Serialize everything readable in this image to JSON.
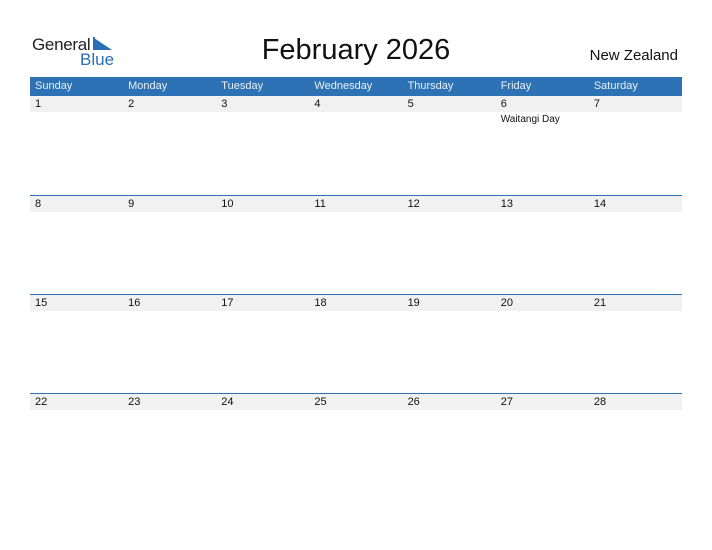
{
  "logo": {
    "line1": "General",
    "line2": "Blue"
  },
  "header": {
    "title": "February 2026",
    "country": "New Zealand"
  },
  "colors": {
    "accent": "#2e72b6",
    "day_bg": "#f1f1f1"
  },
  "weekdays": [
    "Sunday",
    "Monday",
    "Tuesday",
    "Wednesday",
    "Thursday",
    "Friday",
    "Saturday"
  ],
  "weeks": [
    [
      {
        "day": "1",
        "event": ""
      },
      {
        "day": "2",
        "event": ""
      },
      {
        "day": "3",
        "event": ""
      },
      {
        "day": "4",
        "event": ""
      },
      {
        "day": "5",
        "event": ""
      },
      {
        "day": "6",
        "event": "Waitangi Day"
      },
      {
        "day": "7",
        "event": ""
      }
    ],
    [
      {
        "day": "8",
        "event": ""
      },
      {
        "day": "9",
        "event": ""
      },
      {
        "day": "10",
        "event": ""
      },
      {
        "day": "11",
        "event": ""
      },
      {
        "day": "12",
        "event": ""
      },
      {
        "day": "13",
        "event": ""
      },
      {
        "day": "14",
        "event": ""
      }
    ],
    [
      {
        "day": "15",
        "event": ""
      },
      {
        "day": "16",
        "event": ""
      },
      {
        "day": "17",
        "event": ""
      },
      {
        "day": "18",
        "event": ""
      },
      {
        "day": "19",
        "event": ""
      },
      {
        "day": "20",
        "event": ""
      },
      {
        "day": "21",
        "event": ""
      }
    ],
    [
      {
        "day": "22",
        "event": ""
      },
      {
        "day": "23",
        "event": ""
      },
      {
        "day": "24",
        "event": ""
      },
      {
        "day": "25",
        "event": ""
      },
      {
        "day": "26",
        "event": ""
      },
      {
        "day": "27",
        "event": ""
      },
      {
        "day": "28",
        "event": ""
      }
    ]
  ]
}
